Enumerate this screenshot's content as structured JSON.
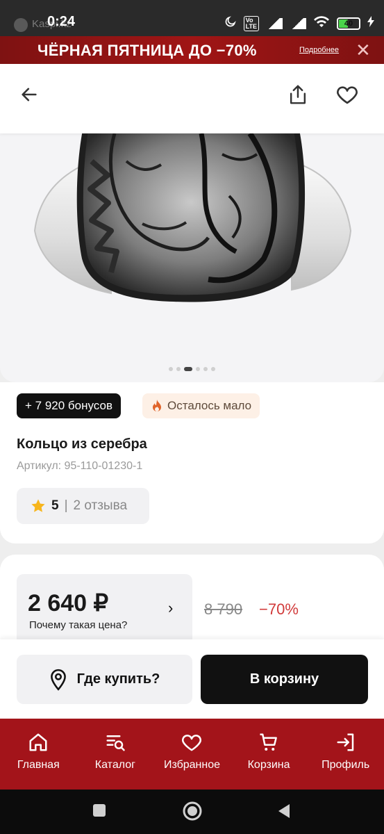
{
  "status_bar": {
    "time": "0:24",
    "app_label": "Kaspi.kz",
    "battery": "40"
  },
  "promo": {
    "text": "ЧЁРНАЯ ПЯТНИЦА  ДО −70%",
    "more_link": "Подробнее",
    "close_glyph": "✕"
  },
  "header": {
    "back_icon": "arrow-left-icon",
    "share_icon": "share-icon",
    "favorite_icon": "heart-icon"
  },
  "gallery": {
    "total_images": 6,
    "active_index": 2
  },
  "product": {
    "bonus_chip": "+ 7 920 бонусов",
    "stock_chip": "Осталось мало",
    "title": "Кольцо из серебра",
    "article": "Артикул: 95-110-01230-1",
    "rating_value": "5",
    "rating_sep": "|",
    "reviews": "2 отзыва"
  },
  "price": {
    "current": "2 640 ₽",
    "why_label": "Почему такая цена?",
    "chevron": "›",
    "old": "8 790",
    "discount": "−70%"
  },
  "actions": {
    "where_buy": "Где купить?",
    "add_to_cart": "В корзину"
  },
  "bottom_nav": {
    "items": [
      {
        "label": "Главная",
        "icon": "home-icon"
      },
      {
        "label": "Каталог",
        "icon": "catalog-icon"
      },
      {
        "label": "Избранное",
        "icon": "heart-icon"
      },
      {
        "label": "Корзина",
        "icon": "cart-icon"
      },
      {
        "label": "Профиль",
        "icon": "login-icon"
      }
    ]
  },
  "colors": {
    "brand_red": "#a3141a",
    "discount_red": "#d13a3a",
    "button_black": "#111111"
  }
}
